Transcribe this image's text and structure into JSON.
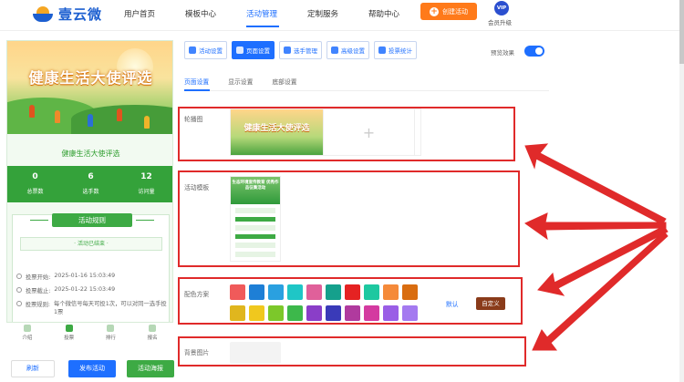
{
  "header": {
    "brand": "壹云微",
    "nav": [
      "用户首页",
      "模板中心",
      "活动管理",
      "定制服务",
      "帮助中心"
    ],
    "active_nav": "活动管理",
    "create_button": "创建活动",
    "vip_badge": "VIP",
    "vip_label": "会员升级"
  },
  "preview": {
    "banner_title": "健康生活大使评选",
    "activity_name": "健康生活大使评选",
    "stats": [
      {
        "value": "0",
        "label": "总票数"
      },
      {
        "value": "6",
        "label": "选手数"
      },
      {
        "value": "12",
        "label": "访问量"
      }
    ],
    "rules_title": "活动规则",
    "ended_text": "· 活动已结束 ·",
    "rules": [
      {
        "label": "投票开始:",
        "value": "2025-01-16 15:03:49"
      },
      {
        "label": "投票截止:",
        "value": "2025-01-22 15:03:49"
      },
      {
        "label": "投票规则:",
        "value": "每个微信号每天可投1次，可以对同一选手投1票"
      }
    ],
    "tabbar": [
      "介绍",
      "投票",
      "排行",
      "报名"
    ],
    "buttons": {
      "refresh": "刷新",
      "publish": "发布活动",
      "poster": "活动海报"
    }
  },
  "toolbar": {
    "items": [
      "活动设置",
      "页面设置",
      "选手管理",
      "高级设置",
      "投票统计"
    ],
    "active": "页面设置",
    "preview_label": "预览效果",
    "preview_enabled": true
  },
  "subtabs": {
    "items": [
      "页面设置",
      "显示设置",
      "底部设置"
    ],
    "active": "页面设置"
  },
  "settings": {
    "carousel_label": "轮播图",
    "carousel_thumb_title": "健康生活大使评选",
    "carousel_add": "+",
    "template_label": "活动模板",
    "template_title": "生态环境宣传教育 优秀作品征集活动",
    "color_label": "配色方案",
    "colors": [
      "#f05a5a",
      "#1e7fd6",
      "#2aa0e0",
      "#1fc6c6",
      "#e0609a",
      "#15a08c",
      "#e52222",
      "#1ec8a0",
      "#f58a3a",
      "#d96d10",
      "#e0b61e",
      "#f0c81e",
      "#7cc82a",
      "#3db84b",
      "#8a3ec8",
      "#3a3ab8",
      "#b03a9e",
      "#d43aa0",
      "#9a5ee6",
      "#a47af0"
    ],
    "default_link": "默认",
    "custom_button": "自定义",
    "background_label": "背景图片"
  }
}
